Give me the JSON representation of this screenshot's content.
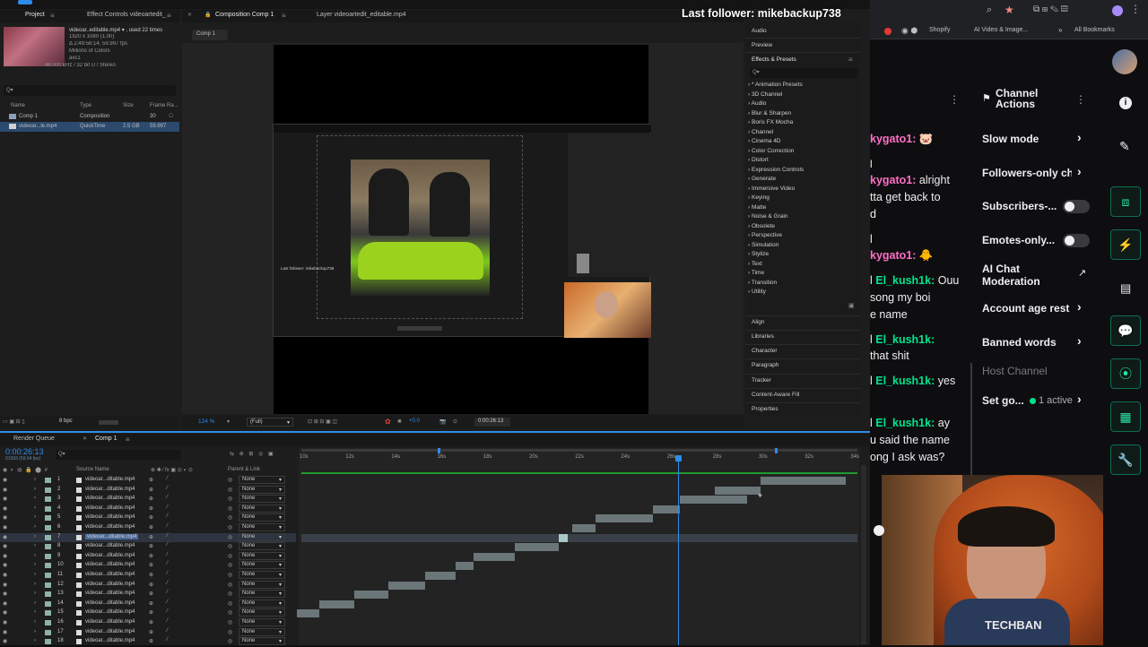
{
  "overlay": {
    "last_follower": "Last follower: mikebackup738"
  },
  "project_panel": {
    "tab_project": "Project",
    "tab_effect_controls": "Effect Controls videoartedit_",
    "file_name": "videoar..editable.mp4 ▾ , used 22 times",
    "file_dims": "1920 x 1080 (1.00)",
    "file_dur": "Δ 2:49:58:14, 59.997 fps",
    "file_colors": "Millions of Colors",
    "file_codec": "avc1",
    "file_audio": "48.000 kHz / 32 bit U / Stereo",
    "search_placeholder": "Q▾",
    "headers": {
      "name": "Name",
      "type": "Type",
      "size": "Size",
      "frame_rate": "Frame Ra..."
    },
    "items": [
      {
        "name": "Comp 1",
        "type": "Composition",
        "size": "",
        "rate": "30"
      },
      {
        "name": "videoar...le.mp4",
        "type": "QuickTime",
        "size": "2.5 GB",
        "rate": "59.997"
      }
    ],
    "bpc": "8 bpc"
  },
  "composition": {
    "tab_composition": "Composition Comp 1",
    "tab_layer": "Layer videoartedit_editable.mp4",
    "breadcrumb": "Comp 1",
    "zoom": "124 %",
    "resolution": "(Full)",
    "exposure": "+0.0",
    "timecode": "0:00:26:13",
    "inner_text": "Last follower: mikebackup738"
  },
  "right_panel": {
    "audio": "Audio",
    "preview": "Preview",
    "effects_title": "Effects & Presets",
    "search_placeholder": "Q▾",
    "effects": [
      "* Animation Presets",
      "3D Channel",
      "Audio",
      "Blur & Sharpen",
      "Boris FX Mocha",
      "Channel",
      "Cinema 4D",
      "Color Correction",
      "Distort",
      "Expression Controls",
      "Generate",
      "Immersive Video",
      "Keying",
      "Matte",
      "Noise & Grain",
      "Obsolete",
      "Perspective",
      "Simulation",
      "Stylize",
      "Text",
      "Time",
      "Transition",
      "Utility"
    ],
    "panels": [
      "Align",
      "Libraries",
      "Character",
      "Paragraph",
      "Tracker",
      "Content-Aware Fill",
      "Properties"
    ]
  },
  "timeline": {
    "tab_render_queue": "Render Queue",
    "tab_comp": "Comp 1",
    "timecode": "0:00:26:13",
    "timecode_sub": "01593 (59.94 fps)",
    "search_placeholder": "Q▾",
    "col_source": "Source Name",
    "col_parent": "Parent & Link",
    "ticks": [
      "10s",
      "12s",
      "14s",
      "16s",
      "18s",
      "20s",
      "22s",
      "24s",
      "26s",
      "28s",
      "30s",
      "32s",
      "34s"
    ],
    "layers": [
      {
        "num": "1",
        "name": "videoar...ditable.mp4",
        "parent": "None",
        "start": 30.0,
        "end": 33.7
      },
      {
        "num": "2",
        "name": "videoar...ditable.mp4",
        "parent": "None",
        "start": 28.0,
        "end": 30.0
      },
      {
        "num": "3",
        "name": "videoar...ditable.mp4",
        "parent": "None",
        "start": 26.5,
        "end": 29.4
      },
      {
        "num": "4",
        "name": "videoar...ditable.mp4",
        "parent": "None",
        "start": 25.3,
        "end": 26.5
      },
      {
        "num": "5",
        "name": "videoar...ditable.mp4",
        "parent": "None",
        "start": 22.8,
        "end": 25.3
      },
      {
        "num": "6",
        "name": "videoar...ditable.mp4",
        "parent": "None",
        "start": 21.8,
        "end": 22.8
      },
      {
        "num": "7",
        "name": "videoar...ditable.mp4",
        "parent": "None",
        "start": 21.2,
        "end": 21.6,
        "selected": true
      },
      {
        "num": "8",
        "name": "videoar...ditable.mp4",
        "parent": "None",
        "start": 19.3,
        "end": 21.2
      },
      {
        "num": "9",
        "name": "videoar...ditable.mp4",
        "parent": "None",
        "start": 17.5,
        "end": 19.3
      },
      {
        "num": "10",
        "name": "videoar...ditable.mp4",
        "parent": "None",
        "start": 16.7,
        "end": 17.5
      },
      {
        "num": "11",
        "name": "videoar...ditable.mp4",
        "parent": "None",
        "start": 15.4,
        "end": 16.7
      },
      {
        "num": "12",
        "name": "videoar...ditable.mp4",
        "parent": "None",
        "start": 13.8,
        "end": 15.4
      },
      {
        "num": "13",
        "name": "videoar...ditable.mp4",
        "parent": "None",
        "start": 12.3,
        "end": 13.8
      },
      {
        "num": "14",
        "name": "videoar...ditable.mp4",
        "parent": "None",
        "start": 10.8,
        "end": 12.3
      },
      {
        "num": "15",
        "name": "videoar...ditable.mp4",
        "parent": "None",
        "start": 9.8,
        "end": 10.8
      },
      {
        "num": "16",
        "name": "videoar...ditable.mp4",
        "parent": "None",
        "start": 9.8,
        "end": 9.8
      },
      {
        "num": "17",
        "name": "videoar...ditable.mp4",
        "parent": "None",
        "start": 9.8,
        "end": 9.8
      },
      {
        "num": "18",
        "name": "videoar...ditable.mp4",
        "parent": "None",
        "start": 9.8,
        "end": 9.8
      }
    ],
    "playhead": 26.4
  },
  "browser": {
    "bookmarks": [
      "Shopify",
      "AI Video & Image...",
      "All Bookmarks"
    ]
  },
  "chat": {
    "lines": [
      {
        "user": "kygato1:",
        "msg": "",
        "top": 0
      },
      {
        "user": "kygato1:",
        "msg": "alright"
      },
      {
        "user": "",
        "msg": "tta get back to"
      },
      {
        "user": "",
        "msg": "d"
      },
      {
        "user": "kygato1:",
        "msg": ""
      },
      {
        "user": "El_kush1k:",
        "msg": "Ouu"
      },
      {
        "user": "",
        "msg": "song my boi"
      },
      {
        "user": "",
        "msg": "e name"
      },
      {
        "user": "El_kush1k:",
        "msg": ""
      },
      {
        "user": "",
        "msg": "that shit"
      },
      {
        "user": "El_kush1k:",
        "msg": "yes"
      },
      {
        "user": "El_kush1k:",
        "msg": "ay"
      },
      {
        "user": "",
        "msg": "u said the name"
      },
      {
        "user": "",
        "msg": "ong I ask was?"
      }
    ]
  },
  "channel_actions": {
    "title": "Channel Actions",
    "slow_mode": "Slow mode",
    "followers_only": "Followers-only ch",
    "subscribers": "Subscribers-...",
    "emotes_only": "Emotes-only...",
    "ai_chat_mod_1": "AI Chat",
    "ai_chat_mod_2": "Moderation",
    "account_age": "Account age rest",
    "banned_words": "Banned words",
    "host_channel": "Host Channel",
    "set_goal": "Set go...",
    "active_count": "1 active"
  },
  "colors": {
    "accent_green": "#00e38d",
    "ae_blue": "#2d8ceb",
    "timeline_bar": "#6b7679"
  }
}
